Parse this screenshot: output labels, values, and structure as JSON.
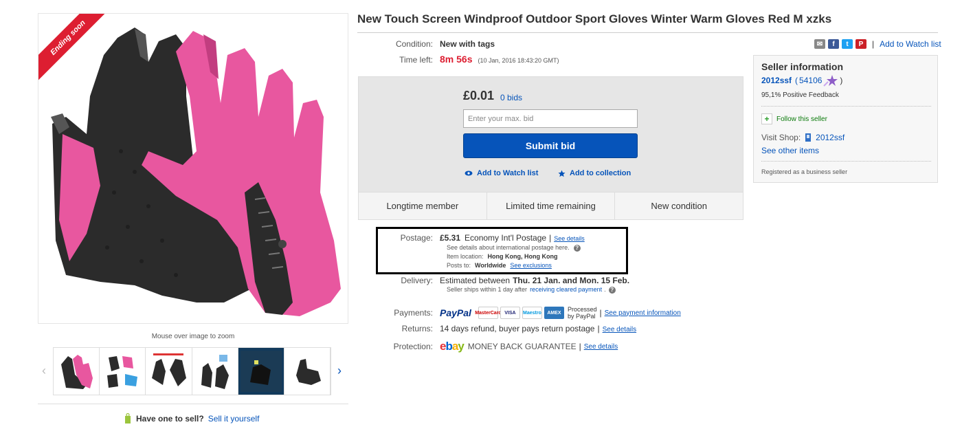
{
  "image": {
    "ribbon": "Ending soon",
    "zoom_hint": "Mouse over image to zoom",
    "thumbnails": [
      "glove-pink",
      "glove-pink-blue",
      "glove-black-pair",
      "glove-black-phone",
      "glove-dark-photo",
      "glove-black-single"
    ]
  },
  "sell": {
    "question": "Have one to sell?",
    "link": "Sell it yourself"
  },
  "item": {
    "title": "New Touch Screen Windproof Outdoor Sport Gloves Winter Warm Gloves Red M xzks",
    "condition_label": "Condition:",
    "condition_value": "New with tags",
    "time_left_label": "Time left:",
    "time_left_value": "8m 56s",
    "time_left_date": "(10 Jan, 2016   18:43:20 GMT)"
  },
  "bid": {
    "price": "£0.01",
    "bids": "0 bids",
    "input_placeholder": "Enter your max. bid",
    "submit": "Submit bid",
    "watch": "Add to Watch list",
    "collection": "Add to collection",
    "badges": [
      "Longtime member",
      "Limited time remaining",
      "New condition"
    ]
  },
  "postage": {
    "label": "Postage:",
    "price": "£5.31",
    "service": "Economy Int'l Postage",
    "see_details": "See details",
    "intl_note": "See details about international postage here.",
    "location_label": "Item location:",
    "location": "Hong Kong, Hong Kong",
    "posts_to_label": "Posts to:",
    "posts_to": "Worldwide",
    "exclusions": "See exclusions"
  },
  "delivery": {
    "label": "Delivery:",
    "prefix": "Estimated between",
    "dates": "Thu. 21 Jan. and Mon. 15 Feb.",
    "ships_note": "Seller ships within 1 day after",
    "cleared": "receiving cleared payment",
    "dot": "."
  },
  "payments": {
    "label": "Payments:",
    "paypal": "PayPal",
    "cards": [
      "MasterCard",
      "VISA",
      "Maestro",
      "AMEX"
    ],
    "processed": "Processed",
    "by_paypal": "by PayPal",
    "link": "See payment information"
  },
  "returns": {
    "label": "Returns:",
    "text": "14 days refund, buyer pays return postage",
    "link": "See details"
  },
  "protection": {
    "label": "Protection:",
    "mbg": "MONEY BACK GUARANTEE",
    "link": "See details"
  },
  "share": {
    "watch_link": "Add to Watch list"
  },
  "seller": {
    "title": "Seller information",
    "name": "2012ssf",
    "score": "54106",
    "paren_close": ")",
    "feedback": "95,1% Positive Feedback",
    "follow": "Follow this seller",
    "visit_label": "Visit Shop:",
    "shop": "2012ssf",
    "other_items": "See other items",
    "registered": "Registered as a business seller"
  },
  "colors": {
    "accent": "#0654ba",
    "alert": "#dd1e31",
    "glove_pink": "#e8579f"
  }
}
